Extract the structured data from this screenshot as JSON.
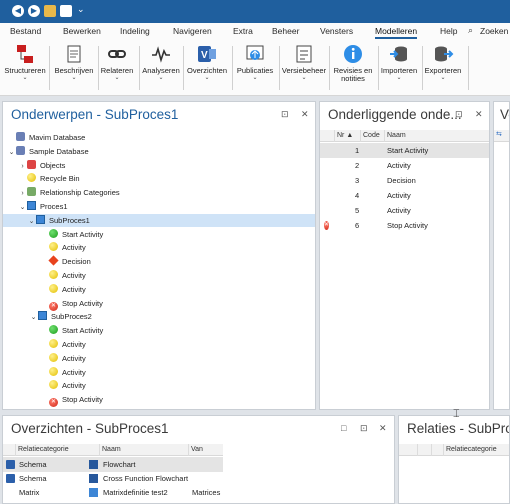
{
  "titlebar": {
    "back": "◀",
    "forward": "▶",
    "quick_access": "⌄"
  },
  "menu": {
    "items": [
      "Bestand",
      "Bewerken",
      "Indeling",
      "Navigeren",
      "Extra",
      "Beheer",
      "Vensters",
      "Modelleren",
      "Help"
    ],
    "active": "Modelleren",
    "search_label": "Zoeken"
  },
  "ribbon": {
    "buttons": [
      {
        "label": "Structureren",
        "icon": "structure-icon"
      },
      {
        "label": "Beschrijven",
        "icon": "describe-icon"
      },
      {
        "label": "Relateren",
        "icon": "link-icon"
      },
      {
        "label": "Analyseren",
        "icon": "analyse-icon"
      },
      {
        "label": "Overzichten",
        "icon": "visio-icon"
      },
      {
        "label": "Publicaties",
        "icon": "publish-icon"
      },
      {
        "label": "Versiebeheer",
        "icon": "version-icon"
      },
      {
        "label": "Revisies en",
        "label2": "notities",
        "icon": "info-icon"
      },
      {
        "label": "Importeren",
        "icon": "import-icon"
      },
      {
        "label": "Exporteren",
        "icon": "export-icon"
      }
    ]
  },
  "onderwerpen": {
    "title": "Onderwerpen -  SubProces1",
    "pin": "⊡",
    "close": "✕",
    "tree": [
      {
        "label": "Mavim Database",
        "level": 0,
        "icon": "database-icon",
        "tw": ""
      },
      {
        "label": "Sample Database",
        "level": 0,
        "icon": "database-icon",
        "tw": "⌄"
      },
      {
        "label": "Objects",
        "level": 1,
        "icon": "objects-icon",
        "tw": "›"
      },
      {
        "label": "Recycle Bin",
        "level": 1,
        "icon": "recycle-icon",
        "tw": ""
      },
      {
        "label": "Relationship Categories",
        "level": 1,
        "icon": "relationship-icon",
        "tw": "›"
      },
      {
        "label": "Proces1",
        "level": 1,
        "icon": "process-icon",
        "tw": "⌄"
      },
      {
        "label": "SubProces1",
        "level": 2,
        "icon": "process-icon",
        "tw": "⌄",
        "selected": true
      },
      {
        "label": "Start Activity",
        "level": 3,
        "icon": "green"
      },
      {
        "label": "Activity",
        "level": 3,
        "icon": "yellow"
      },
      {
        "label": "Decision",
        "level": 3,
        "icon": "diamond"
      },
      {
        "label": "Activity",
        "level": 3,
        "icon": "yellow"
      },
      {
        "label": "Activity",
        "level": 3,
        "icon": "yellow"
      },
      {
        "label": "Stop Activity",
        "level": 3,
        "icon": "red"
      },
      {
        "label": "SubProces2",
        "level": 2,
        "icon": "process-icon",
        "tw": "⌄"
      },
      {
        "label": "Start Activity",
        "level": 3,
        "icon": "green"
      },
      {
        "label": "Activity",
        "level": 3,
        "icon": "yellow"
      },
      {
        "label": "Activity",
        "level": 3,
        "icon": "yellow"
      },
      {
        "label": "Activity",
        "level": 3,
        "icon": "yellow"
      },
      {
        "label": "Activity",
        "level": 3,
        "icon": "yellow"
      },
      {
        "label": "Stop Activity",
        "level": 3,
        "icon": "red"
      }
    ]
  },
  "onderliggende": {
    "title": "Onderliggende onde...",
    "pin": "⊡",
    "close": "✕",
    "columns": [
      "Nr",
      "Code",
      "Naam"
    ],
    "rows": [
      {
        "nr": "1",
        "naam": "Start Activity",
        "icon": "green"
      },
      {
        "nr": "2",
        "naam": "Activity",
        "icon": "yellow"
      },
      {
        "nr": "3",
        "naam": "Decision",
        "icon": "diamond"
      },
      {
        "nr": "4",
        "naam": "Activity",
        "icon": "yellow"
      },
      {
        "nr": "5",
        "naam": "Activity",
        "icon": "yellow"
      },
      {
        "nr": "6",
        "naam": "Stop Activity",
        "icon": "red"
      }
    ]
  },
  "right_partial": {
    "title": "Ve"
  },
  "overzichten": {
    "title": "Overzichten - SubProces1",
    "columns": [
      "Relatiecategorie",
      "Naam",
      "Van"
    ],
    "rows": [
      {
        "cat": "Schema",
        "naam": "Flowchart",
        "van": ""
      },
      {
        "cat": "Schema",
        "naam": "Cross Function Flowchart",
        "van": ""
      },
      {
        "cat": "Matrix",
        "naam": "Matrixdefinitie test2",
        "van": "Matrices"
      }
    ]
  },
  "relaties": {
    "title": "Relaties - SubProce",
    "columns": [
      "Relatiecategorie"
    ]
  }
}
